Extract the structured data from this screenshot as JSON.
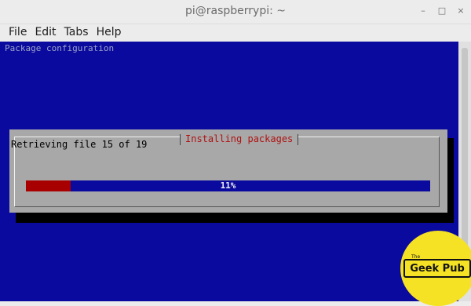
{
  "window": {
    "title": "pi@raspberrypi: ~",
    "controls": {
      "minimize": "–",
      "maximize": "□",
      "close": "×"
    }
  },
  "menu": {
    "items": [
      "File",
      "Edit",
      "Tabs",
      "Help"
    ]
  },
  "terminal": {
    "header_text": "Package configuration",
    "background": "#0a0a9e"
  },
  "dialog": {
    "title": "Installing packages",
    "message": "Retrieving file 15 of 19",
    "progress_percent": 11,
    "progress_label": "11%",
    "fill_color": "#a80000"
  },
  "logo": {
    "the": "The",
    "text": "Geek Pub"
  }
}
